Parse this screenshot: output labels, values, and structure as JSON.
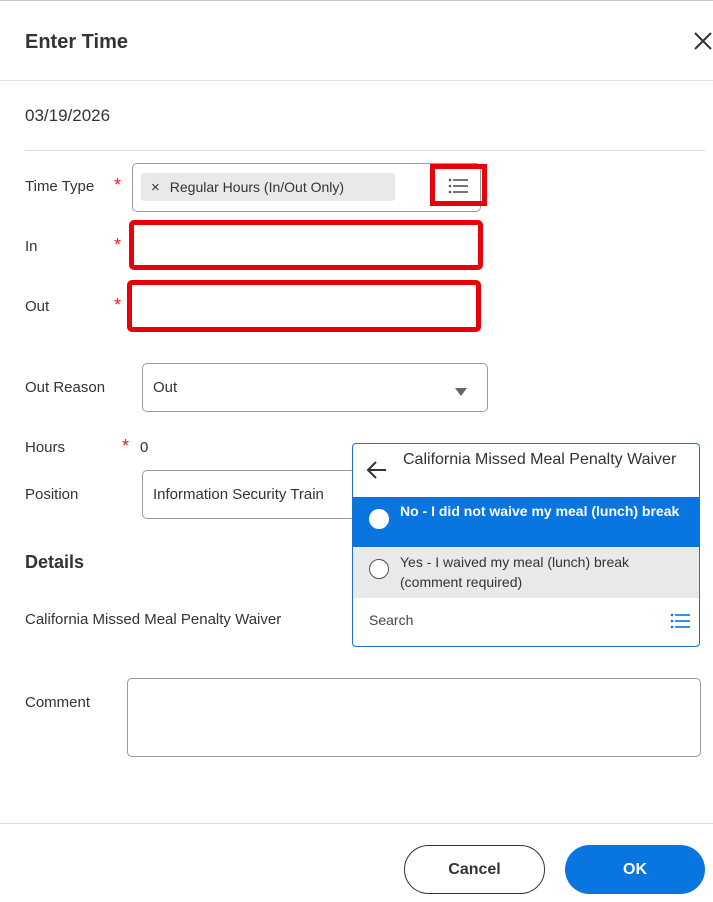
{
  "dialog": {
    "title": "Enter Time",
    "date": "03/19/2026"
  },
  "form": {
    "required_mark": "*",
    "time_type": {
      "label": "Time Type",
      "value": "Regular Hours (In/Out Only)",
      "remove_glyph": "×"
    },
    "in": {
      "label": "In",
      "value": ""
    },
    "out": {
      "label": "Out",
      "value": ""
    },
    "out_reason": {
      "label": "Out Reason",
      "value": "Out"
    },
    "hours": {
      "label": "Hours",
      "value": "0"
    },
    "position": {
      "label": "Position",
      "value": "Information Security Train"
    },
    "details_heading": "Details",
    "meal_waiver": {
      "label": "California Missed Meal Penalty Waiver"
    },
    "comment": {
      "label": "Comment",
      "value": ""
    }
  },
  "popup": {
    "title": "California Missed Meal Penalty Waiver",
    "options": [
      {
        "label": "No - I did not waive my meal (lunch) break",
        "highlighted": true
      },
      {
        "label": "Yes - I waived my meal (lunch) break (comment required)",
        "highlighted": false
      }
    ],
    "search_placeholder": "Search"
  },
  "footer": {
    "cancel_label": "Cancel",
    "ok_label": "OK"
  },
  "colors": {
    "accent": "#0875e1",
    "highlight_red": "#e8000b",
    "required": "#e0202a",
    "selected_option_bg": "#0875e1",
    "hover_option_bg": "#e8e9ea"
  },
  "icons": [
    "close-icon",
    "remove-icon",
    "list-icon",
    "chevron-down-icon",
    "back-arrow-icon",
    "radio-icon"
  ]
}
